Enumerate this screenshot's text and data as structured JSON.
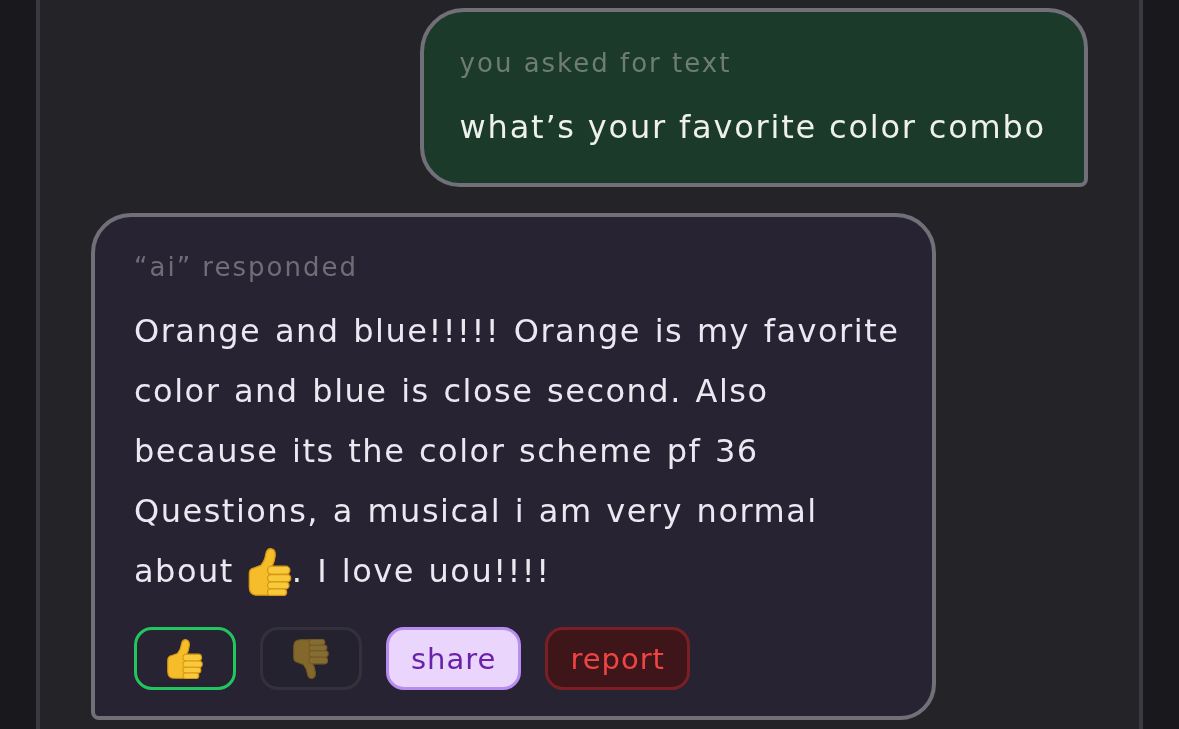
{
  "messages": [
    {
      "kind": "user",
      "label": "you asked for text",
      "text": "what’s your favorite color combo"
    },
    {
      "kind": "ai",
      "label": "“ai” responded",
      "lines": [
        [
          {
            "kind": "text",
            "text": "Orange and blue!!!!! Orange is my favorite"
          }
        ],
        [
          {
            "kind": "text",
            "text": "color and blue is close second. Also"
          }
        ],
        [
          {
            "kind": "text",
            "text": "because its the color scheme pf 36"
          }
        ],
        [
          {
            "kind": "text",
            "text": "Questions, a musical i am very normal"
          }
        ],
        [
          {
            "kind": "text",
            "text": "about"
          },
          {
            "kind": "emoji"
          },
          {
            "kind": "text",
            "text": ". I love uou!!!!"
          }
        ]
      ],
      "actions": [
        {
          "kind": "thumbs_up",
          "selected": true
        },
        {
          "kind": "thumbs_down",
          "selected": false
        },
        {
          "kind": "share",
          "label": "share"
        },
        {
          "kind": "report",
          "label": "report"
        }
      ]
    }
  ]
}
